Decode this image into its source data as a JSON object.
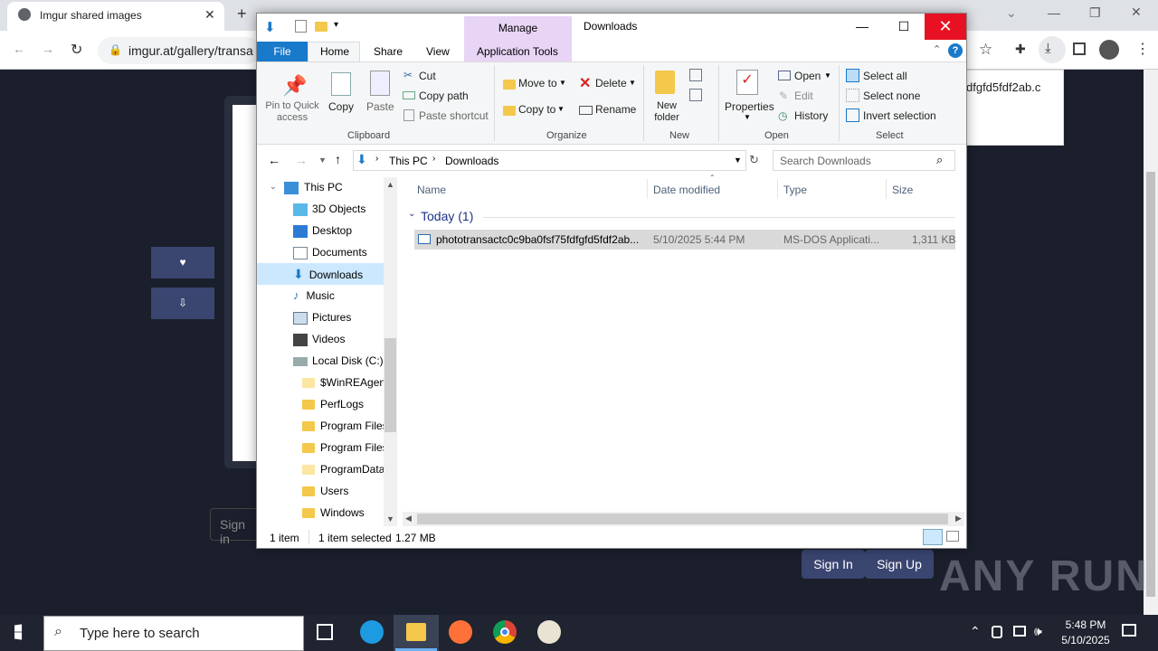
{
  "browser": {
    "tab_title": "Imgur shared images",
    "tab_close": "✕",
    "new_tab": "+",
    "url": "imgur.at/gallery/transa",
    "download_popup_text": "dfgfd5fdf2ab.c"
  },
  "page": {
    "sidebar_btn1": "♥",
    "sidebar_btn2": "⇩",
    "signin_placeholder": "Sign in",
    "signin_button": "Sign In",
    "signup_button": "Sign Up",
    "watermark": "ANY RUN"
  },
  "explorer": {
    "title": "Downloads",
    "manage_tab": "Manage",
    "app_tools_tab": "Application Tools",
    "tabs": [
      "File",
      "Home",
      "Share",
      "View"
    ],
    "clipboard": {
      "pin": "Pin to Quick access",
      "copy": "Copy",
      "paste": "Paste",
      "cut": "Cut",
      "copy_path": "Copy path",
      "paste_shortcut": "Paste shortcut",
      "group": "Clipboard"
    },
    "organize": {
      "move_to": "Move to",
      "copy_to": "Copy to",
      "delete": "Delete",
      "rename": "Rename",
      "group": "Organize"
    },
    "new": {
      "new_folder": "New folder",
      "group": "New"
    },
    "open": {
      "properties": "Properties",
      "open": "Open",
      "edit": "Edit",
      "history": "History",
      "group": "Open"
    },
    "select": {
      "select_all": "Select all",
      "select_none": "Select none",
      "invert": "Invert selection",
      "group": "Select"
    },
    "address": [
      "This PC",
      "Downloads"
    ],
    "search_placeholder": "Search Downloads",
    "nav_items": [
      {
        "label": "This PC"
      },
      {
        "label": "3D Objects"
      },
      {
        "label": "Desktop"
      },
      {
        "label": "Documents"
      },
      {
        "label": "Downloads"
      },
      {
        "label": "Music"
      },
      {
        "label": "Pictures"
      },
      {
        "label": "Videos"
      },
      {
        "label": "Local Disk (C:)"
      },
      {
        "label": "$WinREAgent"
      },
      {
        "label": "PerfLogs"
      },
      {
        "label": "Program Files"
      },
      {
        "label": "Program Files"
      },
      {
        "label": "ProgramData"
      },
      {
        "label": "Users"
      },
      {
        "label": "Windows"
      }
    ],
    "columns": {
      "name": "Name",
      "date": "Date modified",
      "type": "Type",
      "size": "Size"
    },
    "group_header": "Today (1)",
    "file": {
      "name": "phototransactc0c9ba0fsf75fdfgfd5fdf2ab...",
      "date": "5/10/2025 5:44 PM",
      "type": "MS-DOS Applicati...",
      "size": "1,311 KB"
    },
    "status": {
      "items": "1 item",
      "selected": "1 item selected",
      "size": "1.27 MB"
    }
  },
  "taskbar": {
    "search_placeholder": "Type here to search",
    "time": "5:48 PM",
    "date": "5/10/2025"
  }
}
